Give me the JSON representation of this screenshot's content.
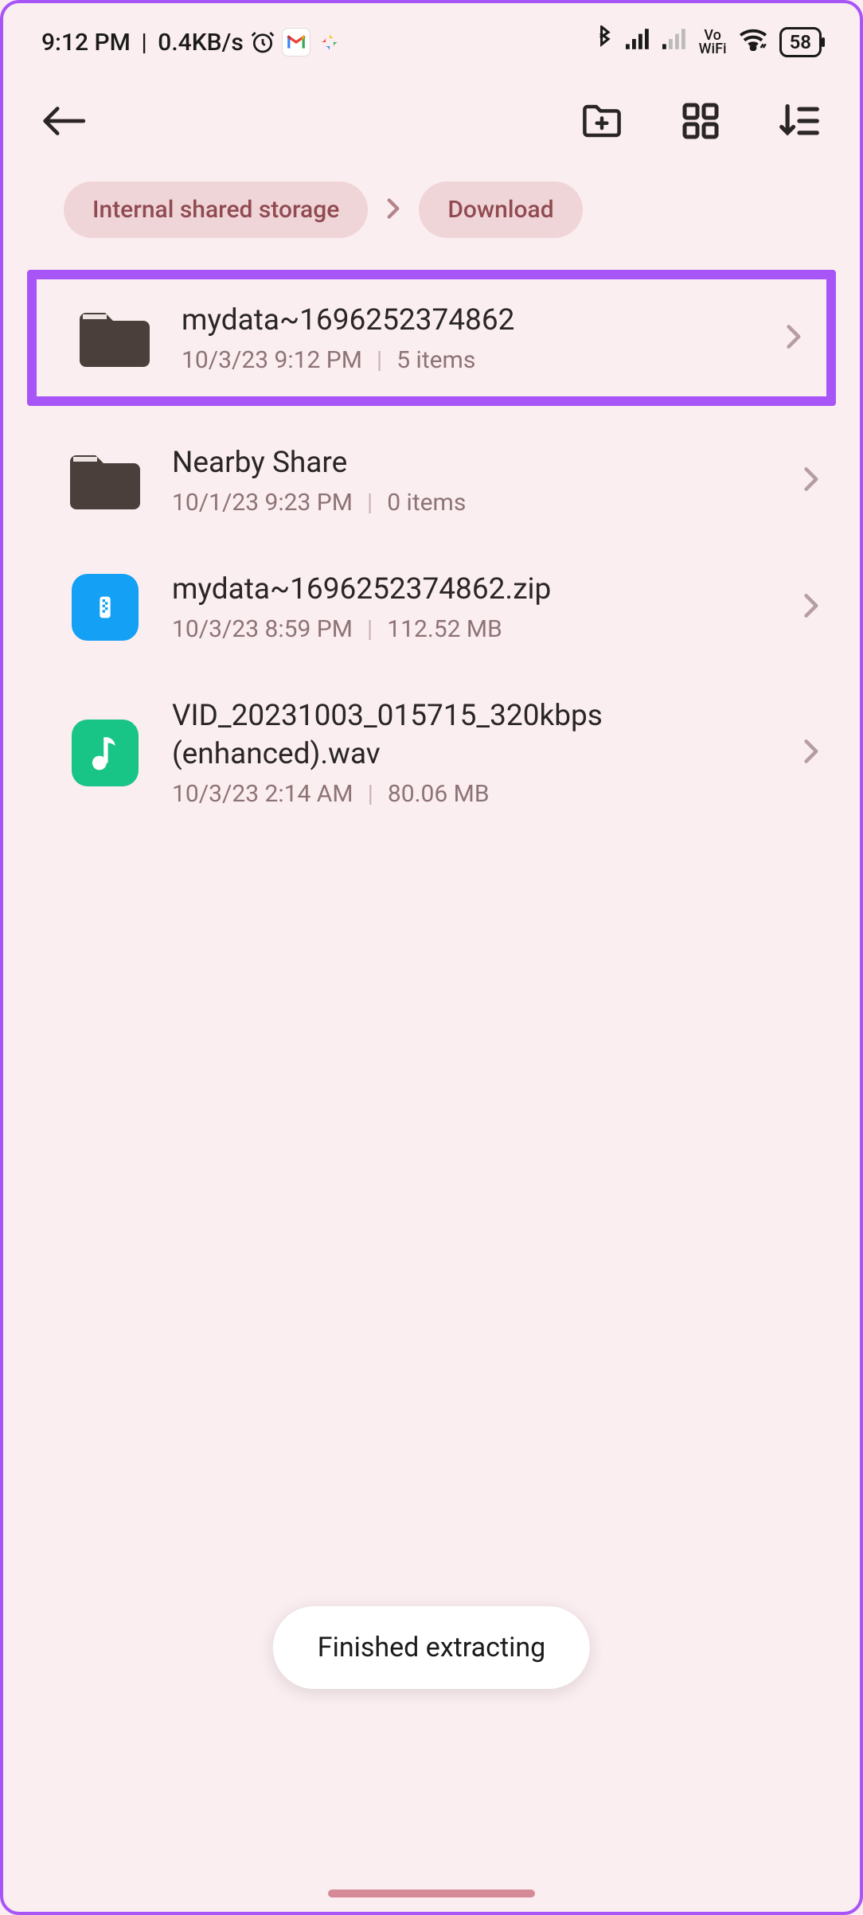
{
  "status": {
    "time": "9:12 PM",
    "net_speed": "0.4KB/s",
    "battery": "58",
    "vo": "Vo",
    "wifi_label": "WiFi"
  },
  "breadcrumb": {
    "root": "Internal shared storage",
    "current": "Download"
  },
  "files": [
    {
      "name": "mydata~1696252374862",
      "date": "10/3/23 9:12 PM",
      "meta": "5 items"
    },
    {
      "name": "Nearby Share",
      "date": "10/1/23 9:23 PM",
      "meta": "0 items"
    },
    {
      "name": "mydata~1696252374862.zip",
      "date": "10/3/23 8:59 PM",
      "meta": "112.52 MB"
    },
    {
      "name": "VID_20231003_015715_320kbps (enhanced).wav",
      "date": "10/3/23 2:14 AM",
      "meta": "80.06 MB"
    }
  ],
  "toast": "Finished extracting"
}
